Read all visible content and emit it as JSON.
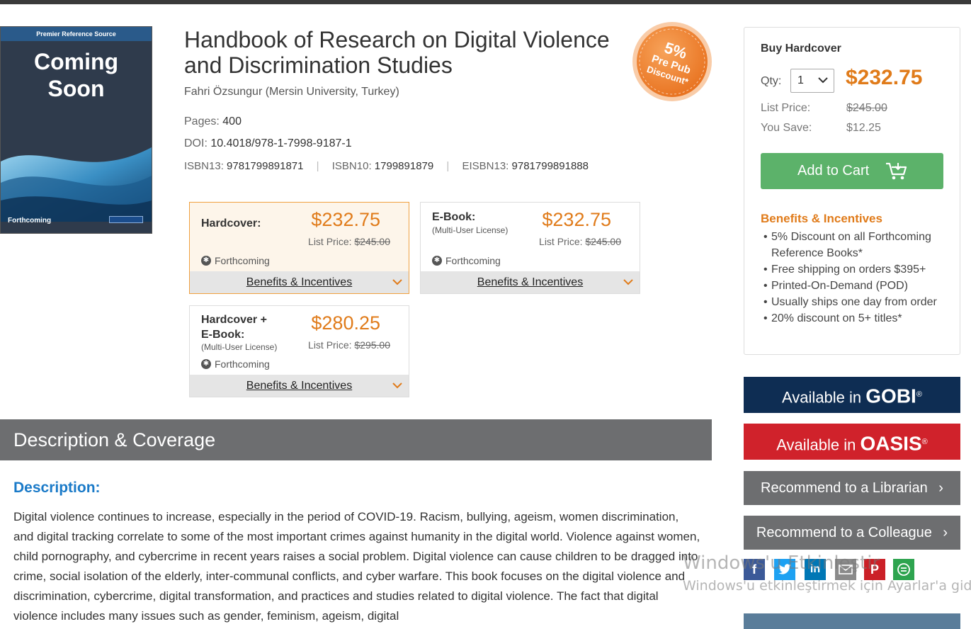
{
  "cover": {
    "band": "Premier Reference Source",
    "line1": "Coming",
    "line2": "Soon",
    "footer": "Forthcoming"
  },
  "book": {
    "title": "Handbook of Research on Digital Violence and Discrimination Studies",
    "author": "Fahri Özsungur (Mersin University, Turkey)",
    "pages_label": "Pages:",
    "pages": "400",
    "doi_label": "DOI:",
    "doi": "10.4018/978-1-7998-9187-1",
    "isbn13_label": "ISBN13:",
    "isbn13": "9781799891871",
    "isbn10_label": "ISBN10:",
    "isbn10": "1799891879",
    "eisbn13_label": "EISBN13:",
    "eisbn13": "9781799891888",
    "separator": "|"
  },
  "badge": {
    "line1": "5%",
    "line2": "Pre Pub",
    "line3": "Discount*"
  },
  "formats": [
    {
      "name": "Hardcover:",
      "license": "",
      "price": "$232.75",
      "list_label": "List Price:",
      "list_price": "$245.00",
      "status": "Forthcoming",
      "benefits": "Benefits & Incentives"
    },
    {
      "name": "E-Book:",
      "license": "(Multi-User License)",
      "price": "$232.75",
      "list_label": "List Price:",
      "list_price": "$245.00",
      "status": "Forthcoming",
      "benefits": "Benefits & Incentives"
    },
    {
      "name_line1": "Hardcover +",
      "name_line2": "E-Book:",
      "license": "(Multi-User License)",
      "price": "$280.25",
      "list_label": "List Price:",
      "list_price": "$295.00",
      "status": "Forthcoming",
      "benefits": "Benefits & Incentives"
    }
  ],
  "buy": {
    "heading": "Buy Hardcover",
    "qty_label": "Qty:",
    "qty_value": "1",
    "price": "$232.75",
    "list_label": "List Price:",
    "list_price": "$245.00",
    "save_label": "You Save:",
    "save_value": "$12.25",
    "cart_label": "Add to Cart",
    "benefits_heading": "Benefits & Incentives",
    "benefits": [
      "5% Discount on all Forthcoming Reference Books*",
      "Free shipping on orders $395+",
      "Printed-On-Demand (POD)",
      "Usually ships one day from order",
      "20% discount on 5+ titles*"
    ]
  },
  "sidebar": {
    "gobi_prefix": "Available in",
    "gobi_brand": "GOBI",
    "oasis_prefix": "Available in",
    "oasis_brand": "OASIS",
    "registered": "®",
    "recommend_librarian": "Recommend to a Librarian",
    "recommend_colleague": "Recommend to a Colleague",
    "share_icons": [
      "facebook-icon",
      "twitter-icon",
      "linkedin-icon",
      "email-icon",
      "pinterest-icon",
      "more-share-icon"
    ]
  },
  "description": {
    "section_title": "Description & Coverage",
    "heading": "Description:",
    "text": "Digital violence continues to increase, especially in the period of COVID-19. Racism, bullying, ageism, women discrimination, and digital tracking correlate to some of the most important crimes against humanity in the digital world. Violence against women, child pornography, and cybercrime in recent years raises a social problem. Digital violence can cause children to be dragged into crime, social isolation of the elderly, inter-communal conflicts, and cyber warfare. This book focuses on the digital violence and discrimination, cybercrime, digital transformation, and practices and studies related to digital violence. The fact that digital violence includes many issues such as gender, feminism, ageism, digital"
  },
  "watermark": {
    "line1": "Windows'u Etkinleştir",
    "line2": "Windows'u etkinleştirmek için Ayarlar'a gidin."
  },
  "colors": {
    "accent": "#e07b1a",
    "cart": "#5cb26a",
    "gobi": "#0e2d53",
    "oasis": "#d0222b",
    "gray_bar": "#6d6e70",
    "link_blue": "#1a7ac8"
  }
}
